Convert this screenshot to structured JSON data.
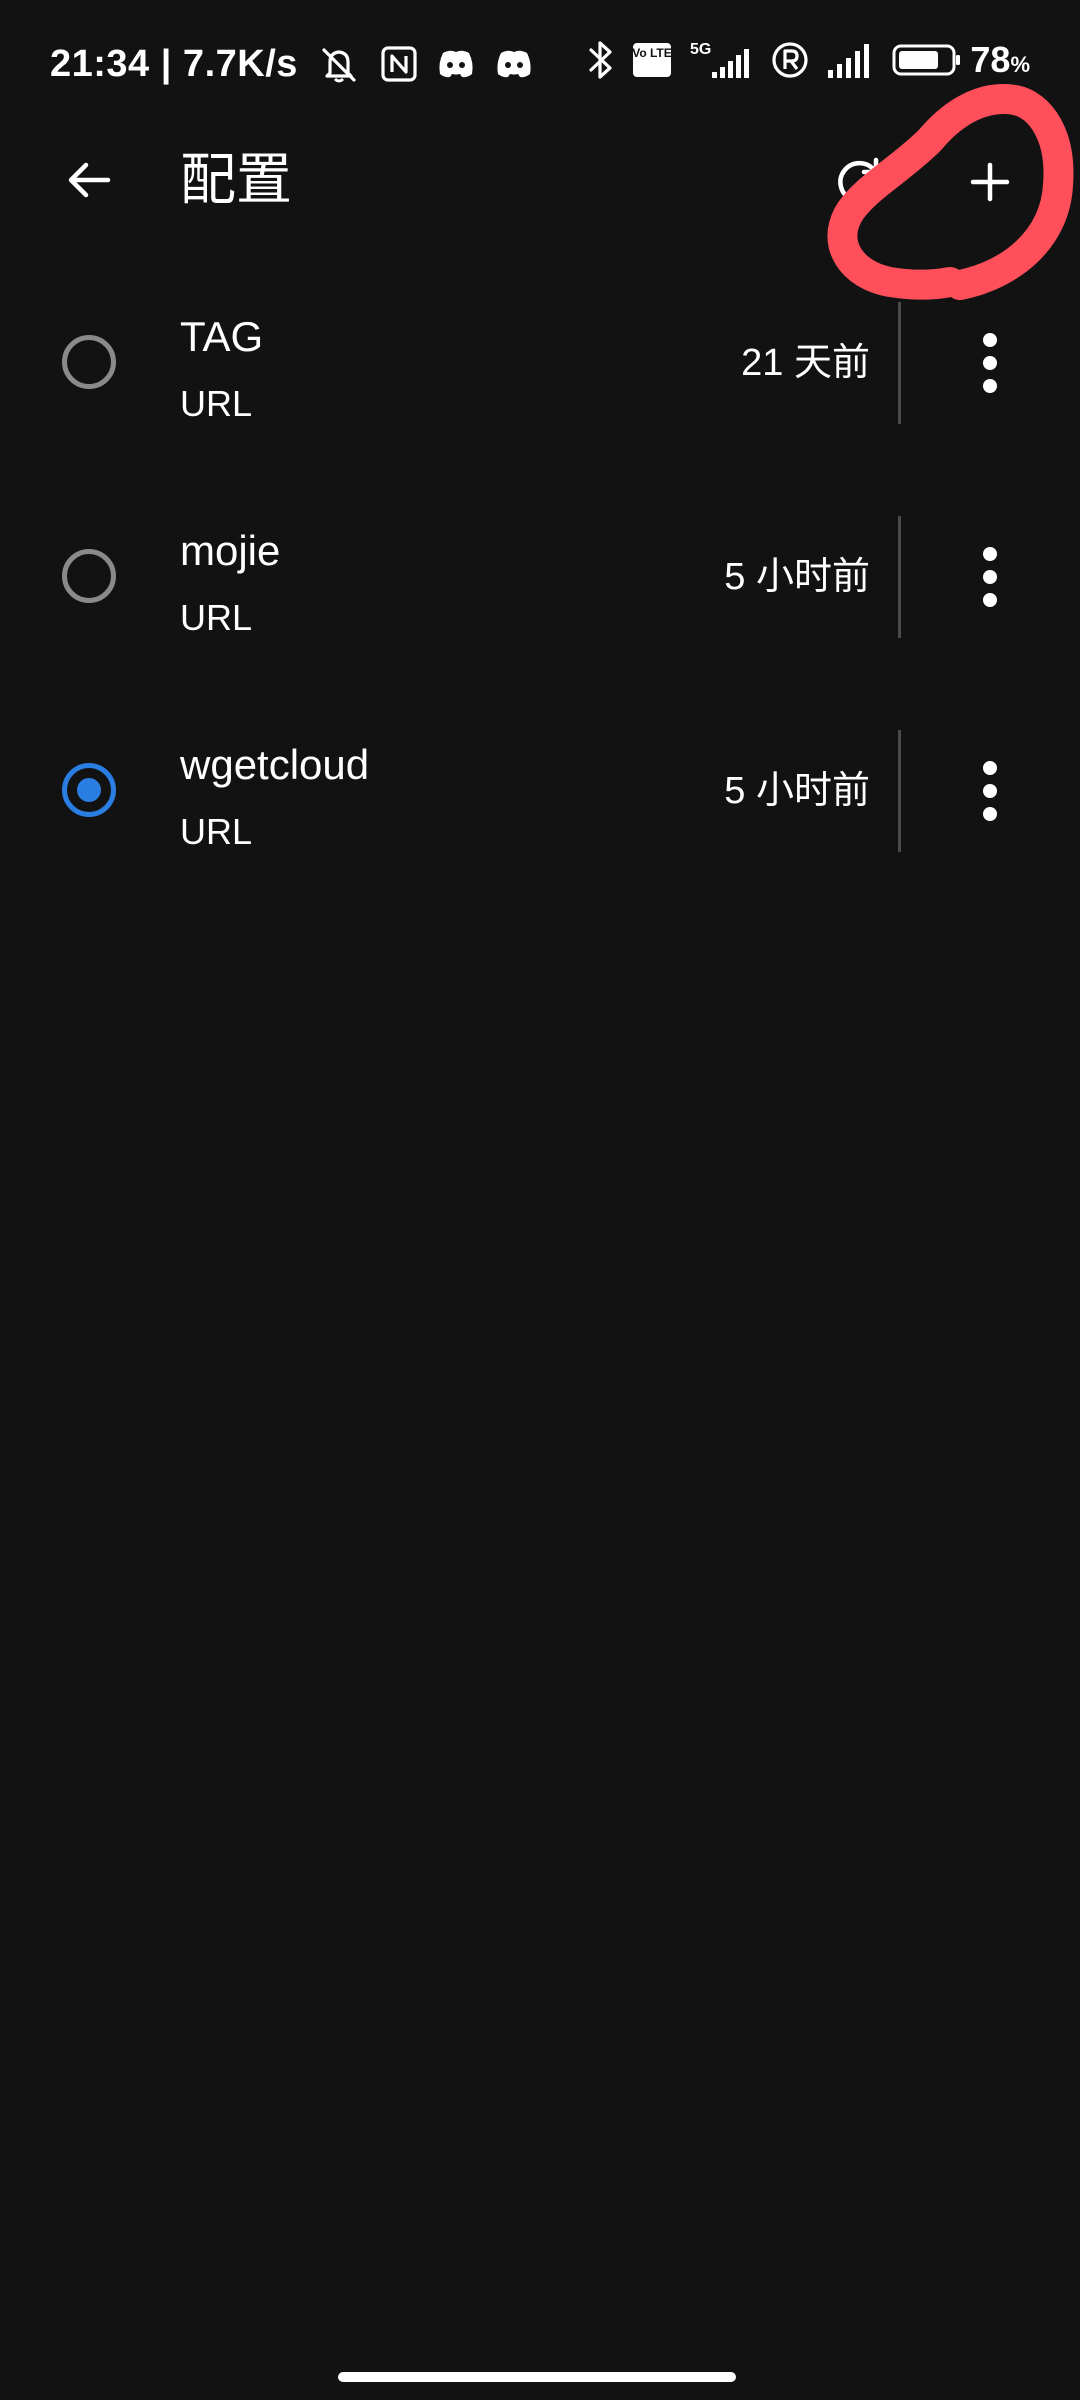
{
  "status_bar": {
    "time_and_speed": "21:34 | 7.7K/s",
    "icons_left": [
      "mute-bell-icon",
      "nfc-icon",
      "discord-icon",
      "discord-icon"
    ],
    "icons_right": [
      "bluetooth-icon",
      "volte-icon",
      "5g-signal-icon",
      "registered-icon",
      "signal-icon",
      "battery-icon"
    ],
    "battery_percent": "78",
    "battery_unit": "%",
    "volte_label": "Vo LTE",
    "network_label": "5G",
    "battery_level": 0.78
  },
  "toolbar": {
    "title": "配置",
    "back_icon": "arrow-back-icon",
    "actions": [
      "refresh-icon",
      "add-icon"
    ]
  },
  "profiles": [
    {
      "name": "TAG",
      "type": "URL",
      "updated": "21 天前",
      "selected": false
    },
    {
      "name": "mojie",
      "type": "URL",
      "updated": "5 小时前",
      "selected": false
    },
    {
      "name": "wgetcloud",
      "type": "URL",
      "updated": "5 小时前",
      "selected": true
    }
  ],
  "colors": {
    "background": "#121212",
    "accent": "#2a7de1",
    "annotation": "#ff4f5a"
  }
}
